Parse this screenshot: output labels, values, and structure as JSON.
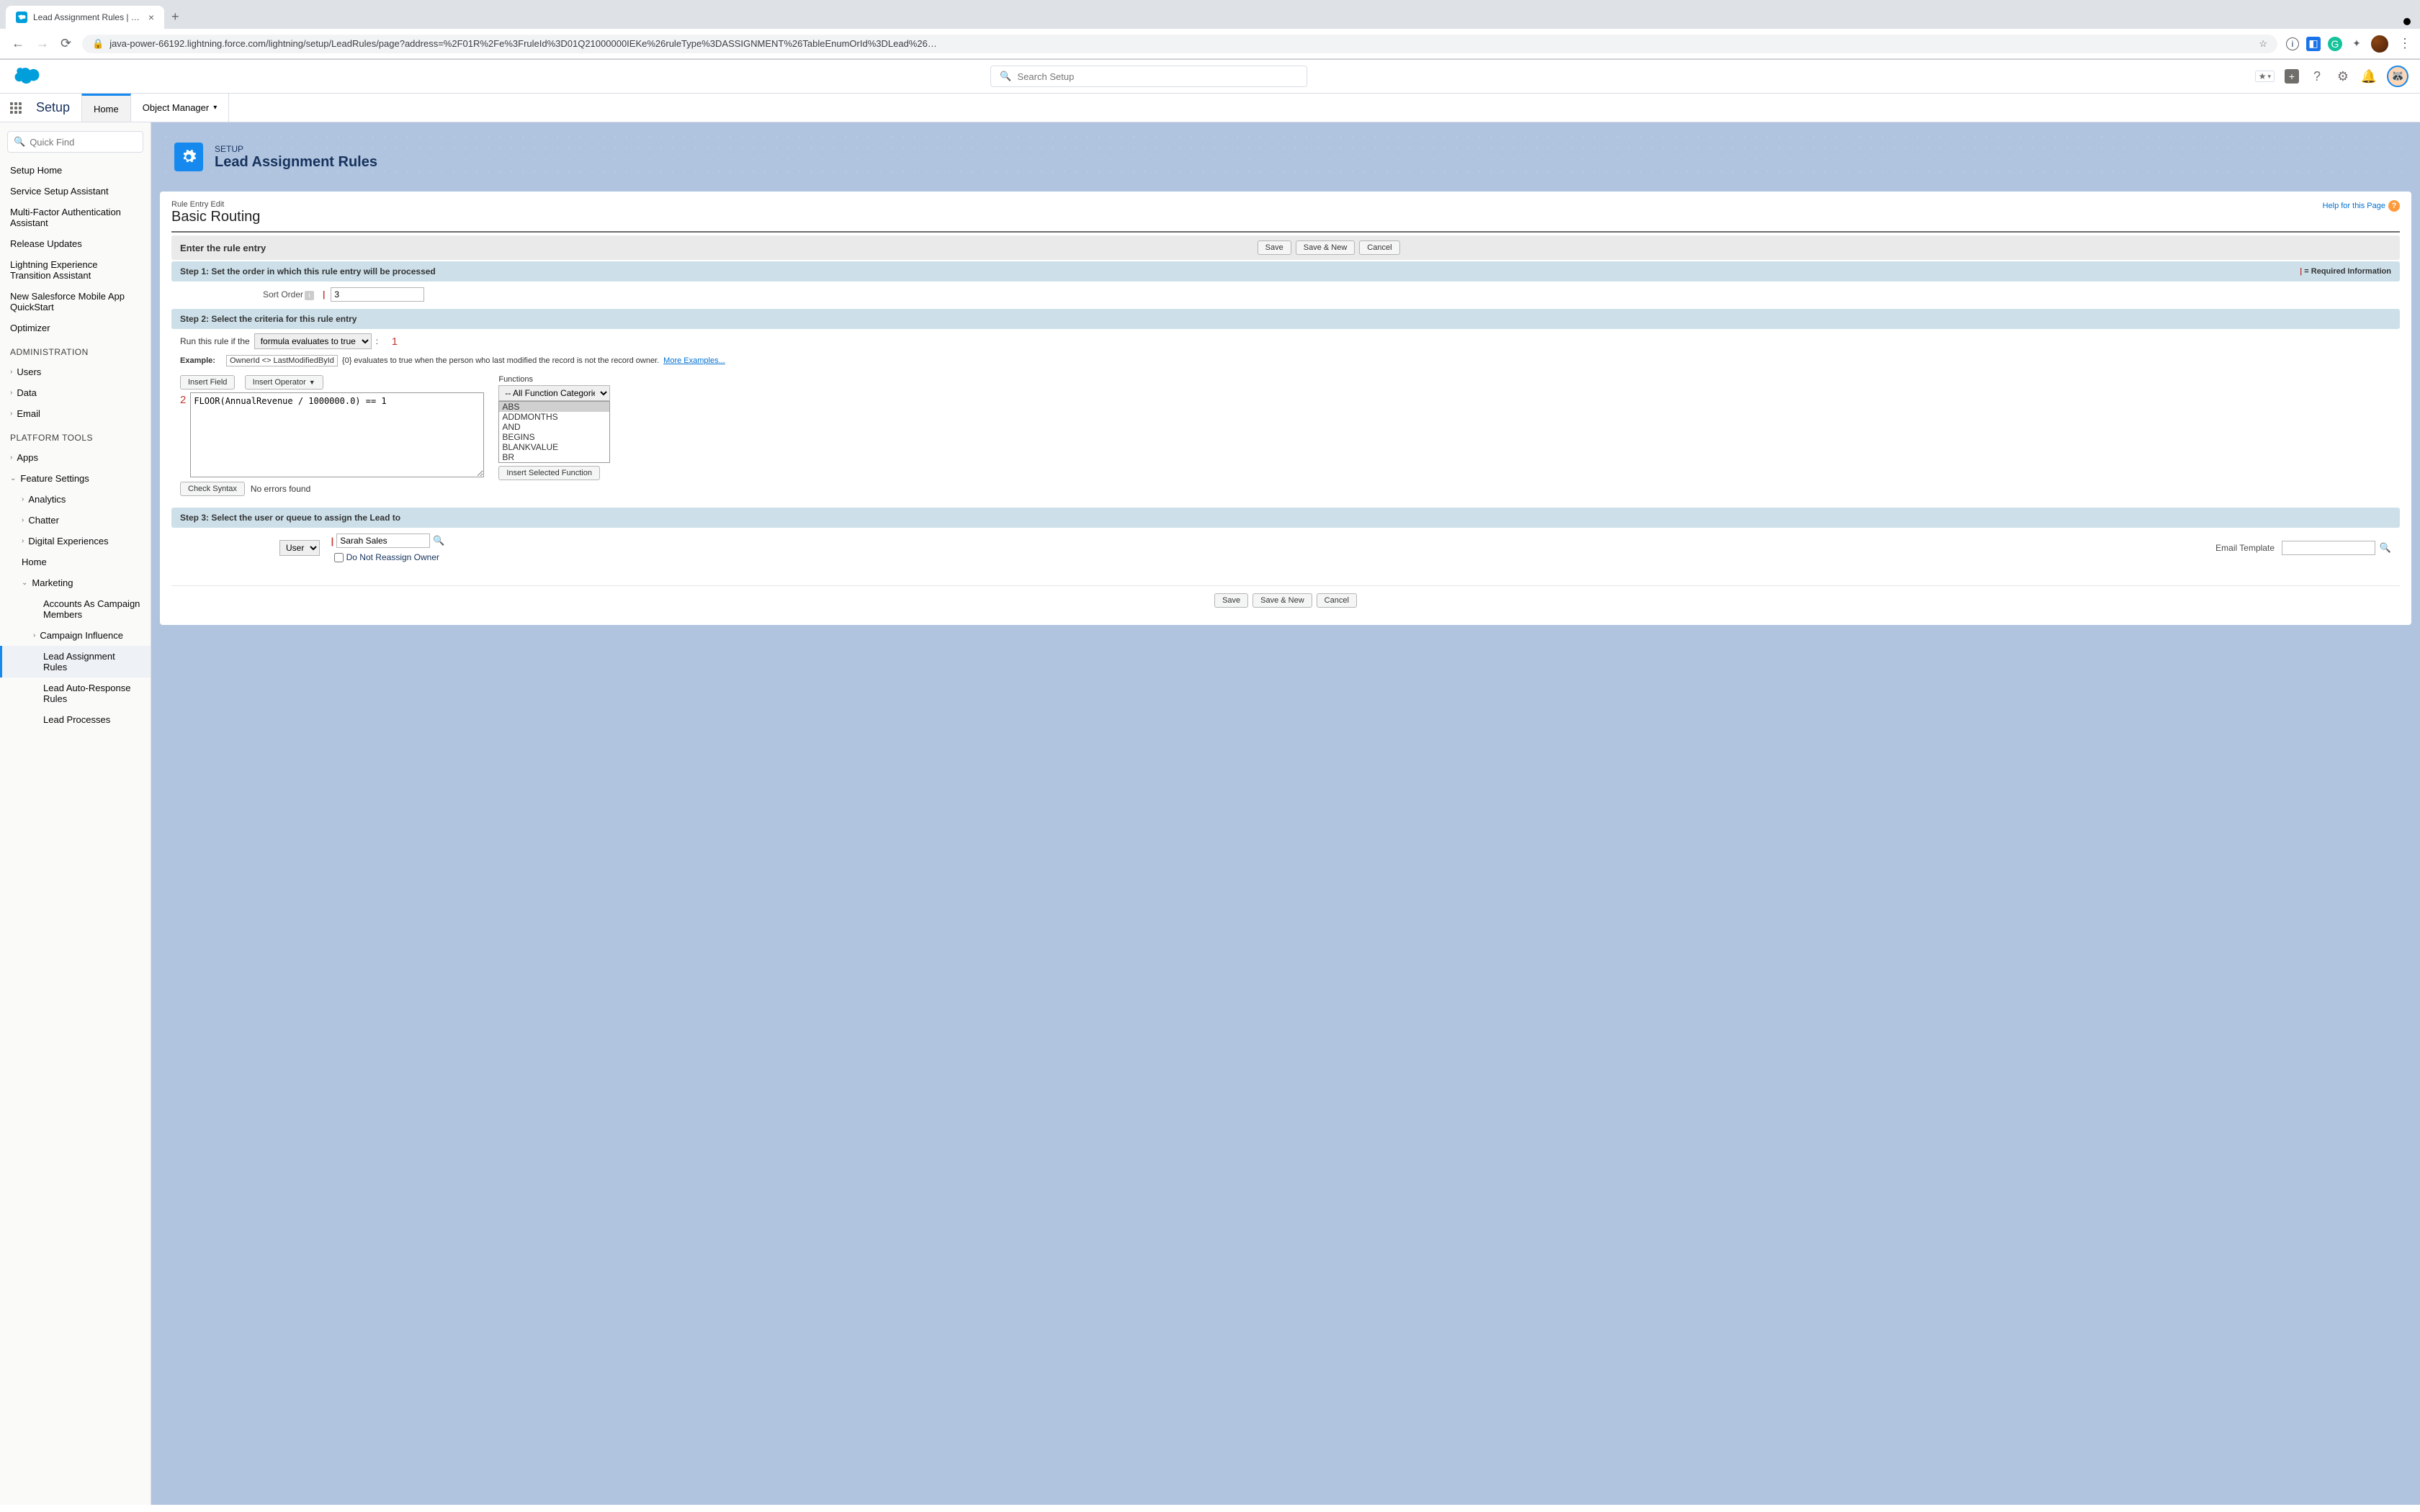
{
  "browser": {
    "tab_title": "Lead Assignment Rules | Sales",
    "url": "java-power-66192.lightning.force.com/lightning/setup/LeadRules/page?address=%2F01R%2Fe%3FruleId%3D01Q21000000IEKe%26ruleType%3DASSIGNMENT%26TableEnumOrId%3DLead%26…"
  },
  "header": {
    "search_placeholder": "Search Setup"
  },
  "context": {
    "app_name": "Setup",
    "home": "Home",
    "object_manager": "Object Manager"
  },
  "sidebar": {
    "quickfind_placeholder": "Quick Find",
    "items_top": [
      "Setup Home",
      "Service Setup Assistant",
      "Multi-Factor Authentication Assistant",
      "Release Updates",
      "Lightning Experience Transition Assistant",
      "New Salesforce Mobile App QuickStart",
      "Optimizer"
    ],
    "admin_label": "ADMINISTRATION",
    "admin_items": [
      "Users",
      "Data",
      "Email"
    ],
    "platform_label": "PLATFORM TOOLS",
    "apps": "Apps",
    "feature_settings": "Feature Settings",
    "analytics": "Analytics",
    "chatter": "Chatter",
    "digital": "Digital Experiences",
    "home": "Home",
    "marketing": "Marketing",
    "marketing_items": [
      "Accounts As Campaign Members",
      "Campaign Influence",
      "Lead Assignment Rules",
      "Lead Auto-Response Rules",
      "Lead Processes"
    ]
  },
  "page": {
    "eyebrow": "SETUP",
    "title": "Lead Assignment Rules",
    "edit_label": "Rule Entry Edit",
    "rule_name": "Basic Routing",
    "help_link": "Help for this Page",
    "enter_rule": "Enter the rule entry",
    "save": "Save",
    "save_new": "Save & New",
    "cancel": "Cancel",
    "step1": "Step 1: Set the order in which this rule entry will be processed",
    "required": "= Required Information",
    "sort_order_label": "Sort Order",
    "sort_order_value": "3",
    "step2": "Step 2: Select the criteria for this rule entry",
    "run_rule_label": "Run this rule if the",
    "criteria_select": "formula evaluates to true",
    "annot1": "1",
    "example_label": "Example:",
    "example_code": "OwnerId <> LastModifiedById",
    "example_desc": " {0} evaluates to true when the person who last modified the record is not the record owner.  ",
    "more_examples": "More Examples...",
    "insert_field": "Insert Field",
    "insert_operator": "Insert Operator",
    "annot2": "2",
    "formula": "FLOOR(AnnualRevenue / 1000000.0) == 1",
    "functions_label": "Functions",
    "func_category": "-- All Function Categories --",
    "func_list": [
      "ABS",
      "ADDMONTHS",
      "AND",
      "BEGINS",
      "BLANKVALUE",
      "BR"
    ],
    "insert_func": "Insert Selected Function",
    "check_syntax": "Check Syntax",
    "syntax_result": "No errors found",
    "step3": "Step 3: Select the user or queue to assign the Lead to",
    "assign_type": "User",
    "assign_value": "Sarah Sales",
    "do_not_reassign": "Do Not Reassign Owner",
    "email_template_label": "Email Template"
  }
}
